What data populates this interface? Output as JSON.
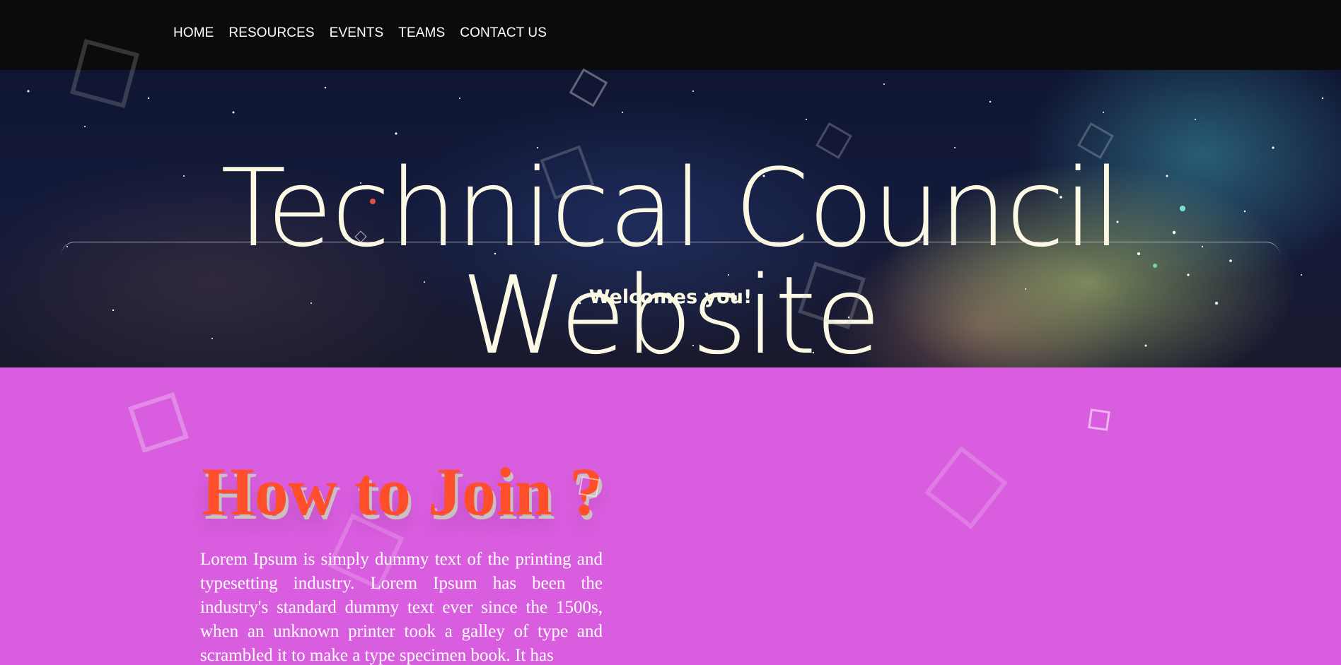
{
  "navbar": {
    "items": [
      {
        "label": "HOME"
      },
      {
        "label": "RESOURCES"
      },
      {
        "label": "EVENTS"
      },
      {
        "label": "TEAMS"
      },
      {
        "label": "CONTACT US"
      }
    ]
  },
  "hero": {
    "title": "Technical Council Website",
    "subtitle": "Welcomes you!"
  },
  "join": {
    "title": "How to Join ?",
    "body": "Lorem Ipsum is simply dummy text of the printing and typesetting industry. Lorem Ipsum has been the industry's standard dummy text ever since the 1500s, when an unknown printer took a galley of type and scrambled it to make a type specimen book. It has"
  },
  "colors": {
    "navbar_bg": "#0b0b0d",
    "section_bg": "#d95ddf",
    "hero_text": "#fbf8e3",
    "join_title": "#ff4f2a"
  }
}
